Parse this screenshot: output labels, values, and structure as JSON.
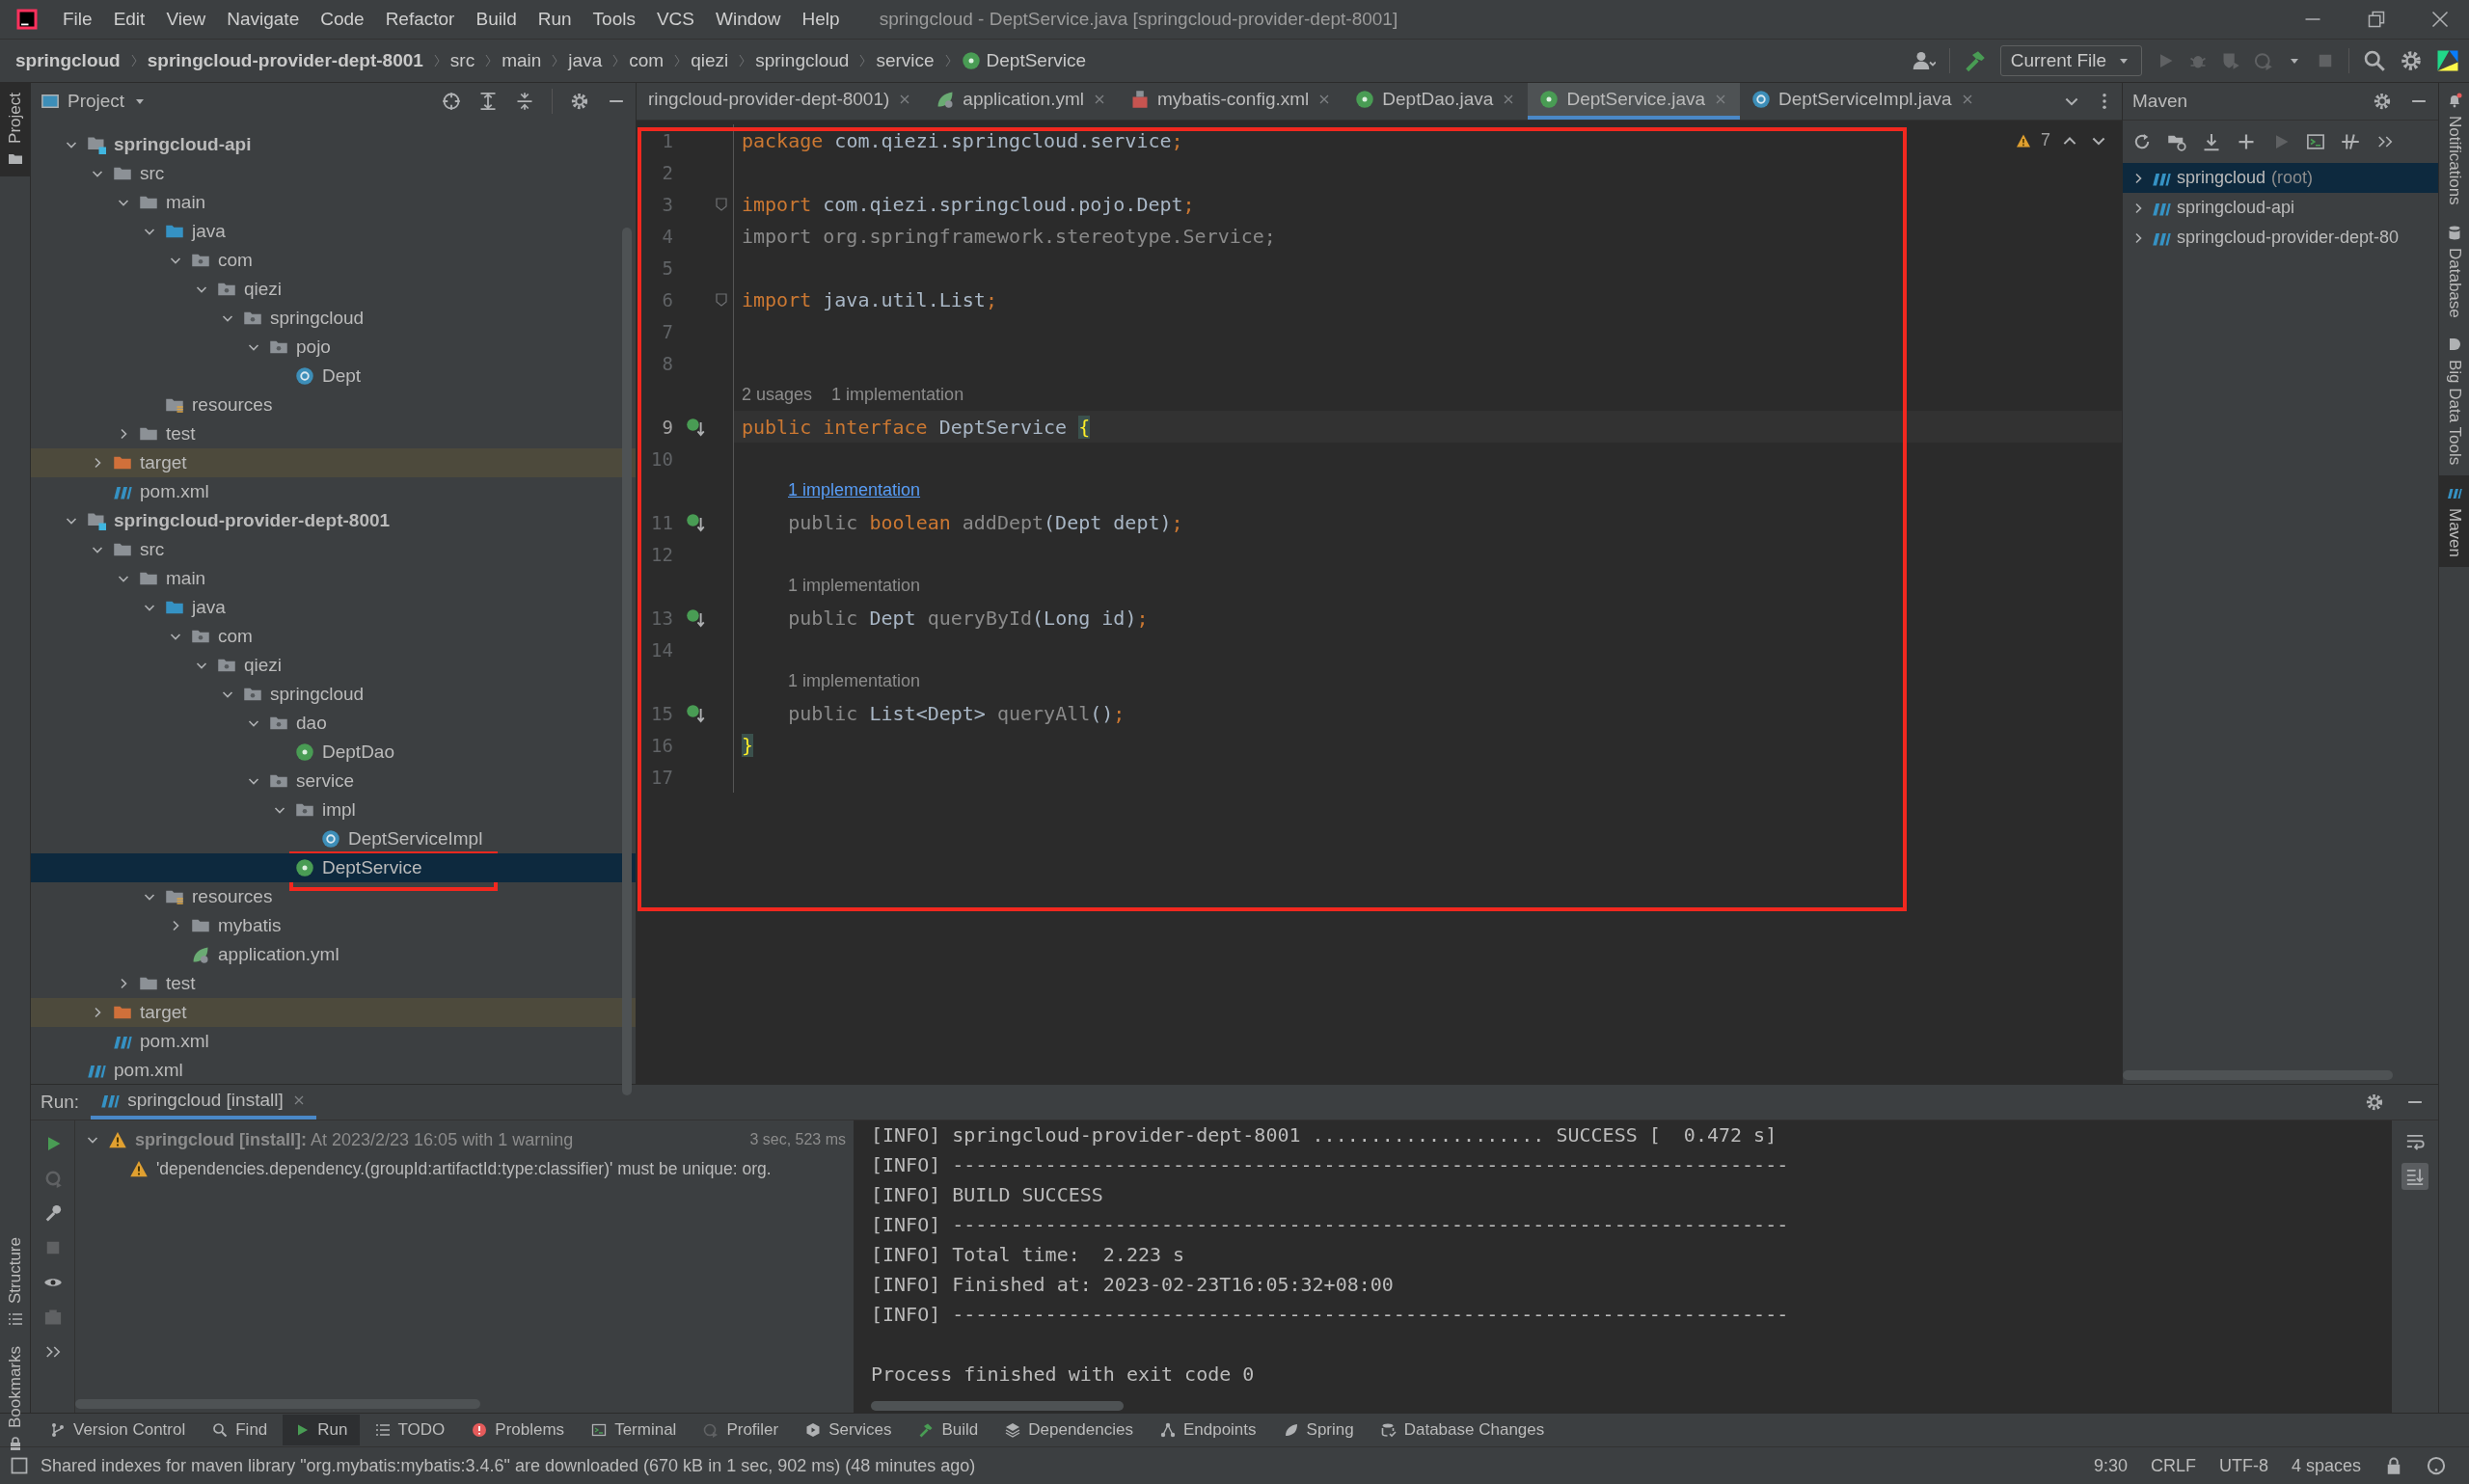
{
  "window": {
    "title": "springcloud - DeptService.java [springcloud-provider-dept-8001]",
    "menu": [
      "File",
      "Edit",
      "View",
      "Navigate",
      "Code",
      "Refactor",
      "Build",
      "Run",
      "Tools",
      "VCS",
      "Window",
      "Help"
    ]
  },
  "breadcrumb": [
    {
      "label": "springcloud",
      "kind": "project"
    },
    {
      "label": "springcloud-provider-dept-8001",
      "kind": "module"
    },
    {
      "label": "src",
      "kind": "folder"
    },
    {
      "label": "main",
      "kind": "folder"
    },
    {
      "label": "java",
      "kind": "folder"
    },
    {
      "label": "com",
      "kind": "folder"
    },
    {
      "label": "qiezi",
      "kind": "folder"
    },
    {
      "label": "springcloud",
      "kind": "folder"
    },
    {
      "label": "service",
      "kind": "folder"
    },
    {
      "label": "DeptService",
      "kind": "interface"
    }
  ],
  "run_configuration": {
    "label": "Current File"
  },
  "left_stripe": [
    {
      "label": "Project",
      "selected": true
    },
    {
      "label": "Structure",
      "selected": false
    },
    {
      "label": "Bookmarks",
      "selected": false
    }
  ],
  "right_stripe": [
    {
      "label": "Notifications",
      "selected": false
    },
    {
      "label": "Database",
      "selected": false
    },
    {
      "label": "Big Data Tools",
      "selected": false
    },
    {
      "label": "Maven",
      "selected": true
    }
  ],
  "project": {
    "title": "Project",
    "tree": [
      {
        "label": "springcloud-api",
        "kind": "module",
        "expanded": true,
        "selected": false,
        "children": [
          {
            "label": "src",
            "kind": "folder",
            "expanded": true,
            "selected": false,
            "children": [
              {
                "label": "main",
                "kind": "folder",
                "expanded": true,
                "selected": false,
                "children": [
                  {
                    "label": "java",
                    "kind": "source",
                    "expanded": true,
                    "selected": false,
                    "children": [
                      {
                        "label": "com",
                        "kind": "package",
                        "expanded": true,
                        "selected": false,
                        "children": [
                          {
                            "label": "qiezi",
                            "kind": "package",
                            "expanded": true,
                            "selected": false,
                            "children": [
                              {
                                "label": "springcloud",
                                "kind": "package",
                                "expanded": true,
                                "selected": false,
                                "children": [
                                  {
                                    "label": "pojo",
                                    "kind": "package",
                                    "expanded": true,
                                    "selected": false,
                                    "children": [
                                      {
                                        "label": "Dept",
                                        "kind": "class",
                                        "selected": false
                                      }
                                    ]
                                  }
                                ]
                              }
                            ]
                          }
                        ]
                      }
                    ]
                  },
                  {
                    "label": "resources",
                    "kind": "resources",
                    "selected": false
                  }
                ]
              },
              {
                "label": "test",
                "kind": "folder",
                "expanded": false,
                "selected": false
              }
            ]
          },
          {
            "label": "target",
            "kind": "excluded",
            "expanded": false,
            "selected": false
          },
          {
            "label": "pom.xml",
            "kind": "maven",
            "selected": false
          }
        ]
      },
      {
        "label": "springcloud-provider-dept-8001",
        "kind": "module",
        "expanded": true,
        "selected": false,
        "children": [
          {
            "label": "src",
            "kind": "folder",
            "expanded": true,
            "selected": false,
            "children": [
              {
                "label": "main",
                "kind": "folder",
                "expanded": true,
                "selected": false,
                "children": [
                  {
                    "label": "java",
                    "kind": "source",
                    "expanded": true,
                    "selected": false,
                    "children": [
                      {
                        "label": "com",
                        "kind": "package",
                        "expanded": true,
                        "selected": false,
                        "children": [
                          {
                            "label": "qiezi",
                            "kind": "package",
                            "expanded": true,
                            "selected": false,
                            "children": [
                              {
                                "label": "springcloud",
                                "kind": "package",
                                "expanded": true,
                                "selected": false,
                                "children": [
                                  {
                                    "label": "dao",
                                    "kind": "package",
                                    "expanded": true,
                                    "selected": false,
                                    "children": [
                                      {
                                        "label": "DeptDao",
                                        "kind": "interface",
                                        "selected": false
                                      }
                                    ]
                                  },
                                  {
                                    "label": "service",
                                    "kind": "package",
                                    "expanded": true,
                                    "selected": false,
                                    "children": [
                                      {
                                        "label": "impl",
                                        "kind": "package",
                                        "expanded": true,
                                        "selected": false,
                                        "children": [
                                          {
                                            "label": "DeptServiceImpl",
                                            "kind": "class",
                                            "selected": false
                                          }
                                        ]
                                      },
                                      {
                                        "label": "DeptService",
                                        "kind": "interface",
                                        "selected": true,
                                        "annotated": true
                                      }
                                    ]
                                  }
                                ]
                              }
                            ]
                          }
                        ]
                      }
                    ]
                  },
                  {
                    "label": "resources",
                    "kind": "resources",
                    "expanded": true,
                    "selected": false,
                    "children": [
                      {
                        "label": "mybatis",
                        "kind": "folder",
                        "expanded": false,
                        "selected": false
                      },
                      {
                        "label": "application.yml",
                        "kind": "yaml",
                        "selected": false
                      }
                    ]
                  }
                ]
              },
              {
                "label": "test",
                "kind": "folder",
                "expanded": false,
                "selected": false
              }
            ]
          },
          {
            "label": "target",
            "kind": "excluded",
            "expanded": false,
            "selected": false
          },
          {
            "label": "pom.xml",
            "kind": "maven",
            "selected": false
          }
        ]
      },
      {
        "label": "pom.xml",
        "kind": "maven",
        "selected": false
      }
    ]
  },
  "editor": {
    "warnings": "7",
    "annotated": true,
    "tabs": [
      {
        "label": "ringcloud-provider-dept-8001)",
        "kind": "partial",
        "selected": false
      },
      {
        "label": "application.yml",
        "kind": "yaml",
        "selected": false
      },
      {
        "label": "mybatis-config.xml",
        "kind": "xml",
        "selected": false
      },
      {
        "label": "DeptDao.java",
        "kind": "interface",
        "selected": false
      },
      {
        "label": "DeptService.java",
        "kind": "interface",
        "selected": true
      },
      {
        "label": "DeptServiceImpl.java",
        "kind": "class",
        "selected": false
      }
    ],
    "lines": [
      {
        "kind": "code",
        "number": "1",
        "current": false,
        "tokens": [
          {
            "kind": "keyword",
            "text": "package"
          },
          {
            "kind": "plain",
            "text": " com.qiezi.springcloud.service"
          },
          {
            "kind": "keyword",
            "text": ";"
          }
        ]
      },
      {
        "kind": "code",
        "number": "2",
        "current": false
      },
      {
        "kind": "code",
        "number": "3",
        "current": false,
        "fold": true,
        "tokens": [
          {
            "kind": "keyword",
            "text": "import"
          },
          {
            "kind": "plain",
            "text": " com.qiezi.springcloud.pojo.Dept"
          },
          {
            "kind": "keyword",
            "text": ";"
          }
        ]
      },
      {
        "kind": "code",
        "number": "4",
        "current": false,
        "tokens": [
          {
            "kind": "unused",
            "text": "import org.springframework.stereotype.Service;"
          }
        ]
      },
      {
        "kind": "code",
        "number": "5",
        "current": false
      },
      {
        "kind": "code",
        "number": "6",
        "current": false,
        "fold": true,
        "tokens": [
          {
            "kind": "keyword",
            "text": "import"
          },
          {
            "kind": "plain",
            "text": " java.util.List"
          },
          {
            "kind": "keyword",
            "text": ";"
          }
        ]
      },
      {
        "kind": "code",
        "number": "7",
        "current": false
      },
      {
        "kind": "code",
        "number": "8",
        "current": false
      },
      {
        "kind": "hint",
        "indented": false,
        "parts": [
          {
            "text": "2 usages",
            "link": false
          },
          {
            "text": "1 implementation",
            "link": false
          }
        ]
      },
      {
        "kind": "code",
        "number": "9",
        "current": true,
        "implemented": true,
        "tokens": [
          {
            "kind": "keyword",
            "text": "public"
          },
          {
            "kind": "keyword",
            "text": " interface"
          },
          {
            "kind": "plain",
            "text": " DeptService "
          },
          {
            "kind": "brace",
            "text": "{"
          }
        ]
      },
      {
        "kind": "code",
        "number": "10",
        "current": false
      },
      {
        "kind": "hint",
        "indented": true,
        "parts": [
          {
            "text": "1 implementation",
            "link": true
          }
        ]
      },
      {
        "kind": "code",
        "number": "11",
        "current": false,
        "implemented": true,
        "tokens": [
          {
            "kind": "unused",
            "text": "    public"
          },
          {
            "kind": "keyword",
            "text": " boolean"
          },
          {
            "kind": "unused",
            "text": " addDept"
          },
          {
            "kind": "plain",
            "text": "(Dept dept)"
          },
          {
            "kind": "keyword",
            "text": ";"
          }
        ]
      },
      {
        "kind": "code",
        "number": "12",
        "current": false
      },
      {
        "kind": "hint",
        "indented": true,
        "parts": [
          {
            "text": "1 implementation",
            "link": false
          }
        ]
      },
      {
        "kind": "code",
        "number": "13",
        "current": false,
        "implemented": true,
        "tokens": [
          {
            "kind": "unused",
            "text": "    public"
          },
          {
            "kind": "plain",
            "text": " Dept "
          },
          {
            "kind": "unused",
            "text": "queryById"
          },
          {
            "kind": "plain",
            "text": "(Long id)"
          },
          {
            "kind": "keyword",
            "text": ";"
          }
        ]
      },
      {
        "kind": "code",
        "number": "14",
        "current": false
      },
      {
        "kind": "hint",
        "indented": true,
        "parts": [
          {
            "text": "1 implementation",
            "link": false
          }
        ]
      },
      {
        "kind": "code",
        "number": "15",
        "current": false,
        "implemented": true,
        "tokens": [
          {
            "kind": "unused",
            "text": "    public"
          },
          {
            "kind": "plain",
            "text": " List<Dept> "
          },
          {
            "kind": "unused",
            "text": "queryAll"
          },
          {
            "kind": "plain",
            "text": "()"
          },
          {
            "kind": "keyword",
            "text": ";"
          }
        ]
      },
      {
        "kind": "code",
        "number": "16",
        "current": false,
        "tokens": [
          {
            "kind": "brace",
            "text": "}"
          }
        ]
      },
      {
        "kind": "code",
        "number": "17",
        "current": false
      }
    ]
  },
  "maven": {
    "title": "Maven",
    "tree": [
      {
        "label": "springcloud",
        "note": "(root)",
        "expanded": false,
        "selected": true
      },
      {
        "label": "springcloud-api",
        "expanded": false,
        "selected": false
      },
      {
        "label": "springcloud-provider-dept-80",
        "expanded": false,
        "selected": false
      }
    ]
  },
  "run": {
    "label": "Run:",
    "tab": "springcloud [install]",
    "tree": [
      {
        "text": "**springcloud [install]:** At 2023/2/23 16:05 with 1 warning",
        "time": "3 sec, 523 ms",
        "expanded": true,
        "children": [
          {
            "text": "'dependencies.dependency.(groupId:artifactId:type:classifier)' must be unique: org."
          }
        ]
      }
    ],
    "console": [
      {
        "kind": "info",
        "text": "[INFO] springcloud-provider-dept-8001 .................... SUCCESS [  0.472 s]"
      },
      {
        "kind": "info",
        "text": "[INFO] ------------------------------------------------------------------------"
      },
      {
        "kind": "info",
        "text": "[INFO] BUILD SUCCESS"
      },
      {
        "kind": "info",
        "text": "[INFO] ------------------------------------------------------------------------"
      },
      {
        "kind": "info",
        "text": "[INFO] Total time:  2.223 s"
      },
      {
        "kind": "info",
        "text": "[INFO] Finished at: 2023-02-23T16:05:32+08:00"
      },
      {
        "kind": "info",
        "text": "[INFO] ------------------------------------------------------------------------"
      },
      {
        "kind": "exit",
        "text": "Process finished with exit code 0"
      }
    ]
  },
  "tool_windows": [
    {
      "label": "Version Control",
      "selected": false
    },
    {
      "label": "Find",
      "selected": false
    },
    {
      "label": "Run",
      "selected": true
    },
    {
      "label": "TODO",
      "selected": false
    },
    {
      "label": "Problems",
      "selected": false
    },
    {
      "label": "Terminal",
      "selected": false
    },
    {
      "label": "Profiler",
      "selected": false
    },
    {
      "label": "Services",
      "selected": false
    },
    {
      "label": "Build",
      "selected": false
    },
    {
      "label": "Dependencies",
      "selected": false
    },
    {
      "label": "Endpoints",
      "selected": false
    },
    {
      "label": "Spring",
      "selected": false
    },
    {
      "label": "Database Changes",
      "selected": false
    }
  ],
  "status_bar": {
    "message": "Shared indexes for maven library \"org.mybatis:mybatis:3.4.6\" are downloaded (670 kB in 1 sec, 902 ms) (48 minutes ago)",
    "items": [
      "9:30",
      "CRLF",
      "UTF-8",
      "4 spaces"
    ]
  }
}
